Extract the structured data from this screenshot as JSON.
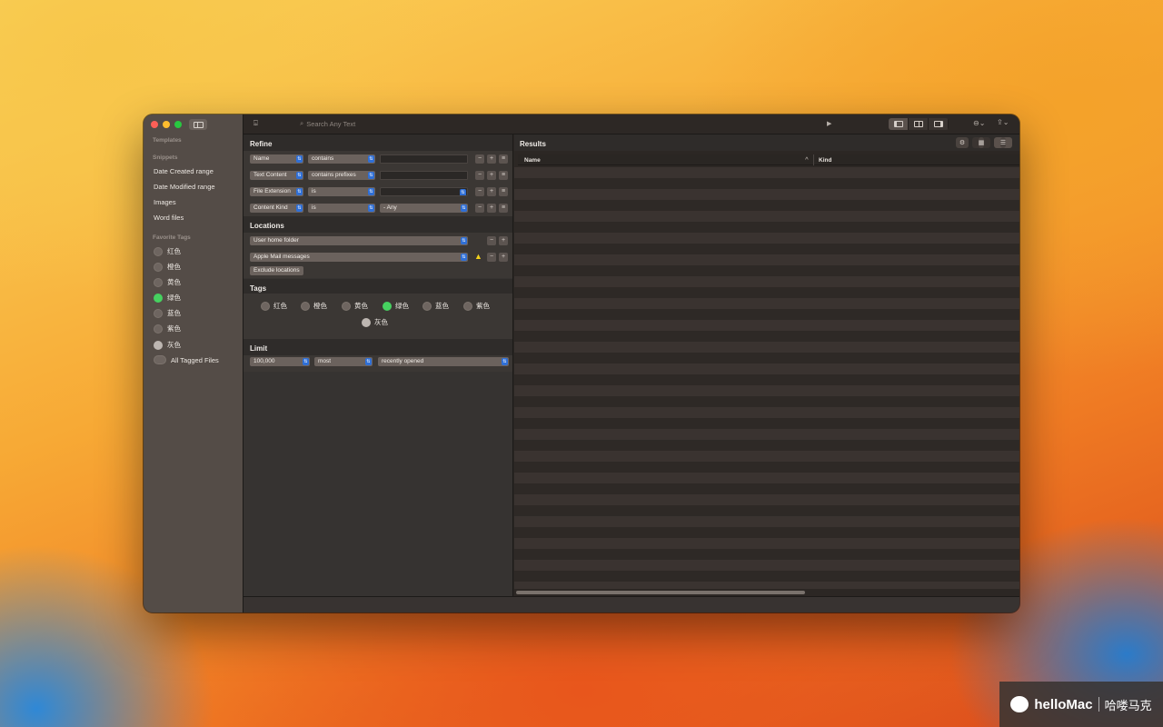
{
  "sidebar": {
    "templates_label": "Templates",
    "snippets_label": "Snippets",
    "snippets": [
      "Date Created range",
      "Date Modified range",
      "Images",
      "Word files"
    ],
    "favorite_tags_label": "Favorite Tags",
    "tags": [
      "红色",
      "橙色",
      "黄色",
      "绿色",
      "蓝色",
      "紫色",
      "灰色"
    ],
    "all_tagged": "All Tagged Files"
  },
  "toolbar": {
    "search_placeholder": "Search Any Text"
  },
  "query": {
    "refine_title": "Refine",
    "rows": [
      {
        "attribute": "Name",
        "operator": "contains",
        "value": ""
      },
      {
        "attribute": "Text Content",
        "operator": "contains prefixes",
        "value": ""
      },
      {
        "attribute": "File Extension",
        "operator": "is",
        "value": ""
      },
      {
        "attribute": "Content Kind",
        "operator": "is",
        "value": "- Any"
      }
    ],
    "locations_title": "Locations",
    "locations": [
      "User home folder",
      "Apple Mail messages"
    ],
    "exclude_button": "Exclude locations",
    "tags_title": "Tags",
    "tags": [
      "红色",
      "橙色",
      "黄色",
      "绿色",
      "蓝色",
      "紫色",
      "灰色"
    ],
    "limit_title": "Limit",
    "limit": {
      "count": "100,000",
      "order": "most",
      "criteria": "recently opened"
    }
  },
  "results": {
    "title": "Results",
    "columns": [
      "Name",
      "Kind"
    ]
  },
  "watermark": {
    "brand": "helloMac",
    "cn": "哈喽马克"
  },
  "colors": {
    "accent": "#2f6fd6",
    "green_tag": "#46d160",
    "warning": "#f3d21b"
  }
}
